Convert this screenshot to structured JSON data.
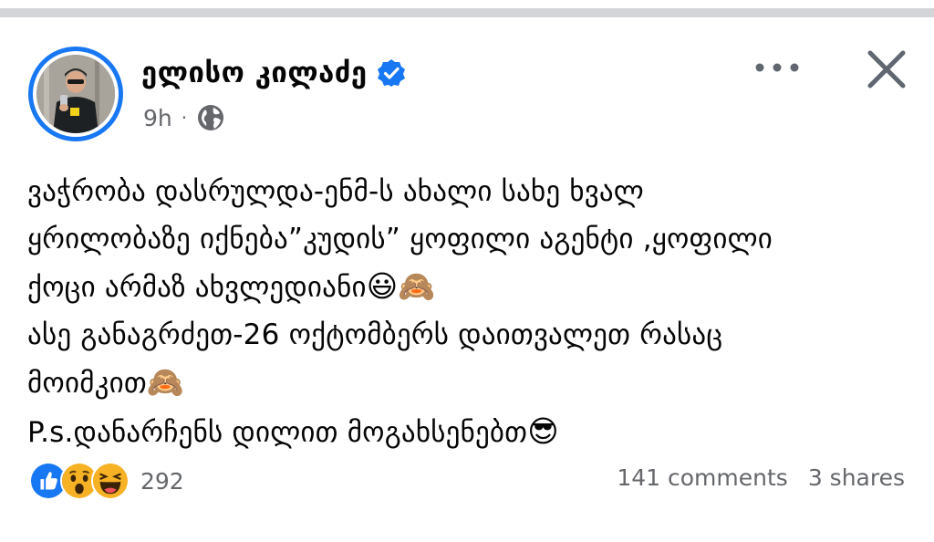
{
  "post": {
    "author_name": "ელისო კილაძე",
    "timestamp": "9h",
    "separator": "·",
    "audience_icon": "globe-icon",
    "lines": [
      "ვაჭრობა დასრულდა-ენმ-ს ახალი სახე ხვალ",
      "ყრილობაზე იქნება”კუდის” ყოფილი აგენტი ,ყოფილი",
      "ქოცი არმაზ ახვლედიანი",
      "ასე განაგრძეთ-26 ოქტომბერს დაითვალეთ რასაც",
      "მოიმკით",
      "P.s.დანარჩენს დილით მოგახსენებთ"
    ],
    "emojis": {
      "line3": "😃🙈",
      "line5": "🙈",
      "line6": "😎"
    }
  },
  "reactions": {
    "icons": [
      "like-icon",
      "wow-icon",
      "haha-icon"
    ],
    "count": "292"
  },
  "stats": {
    "comments": "141 comments",
    "shares": "3 shares"
  },
  "colors": {
    "accent": "#1877f2",
    "secondary_text": "#65676b",
    "top_bar": "#d4d5d9"
  }
}
